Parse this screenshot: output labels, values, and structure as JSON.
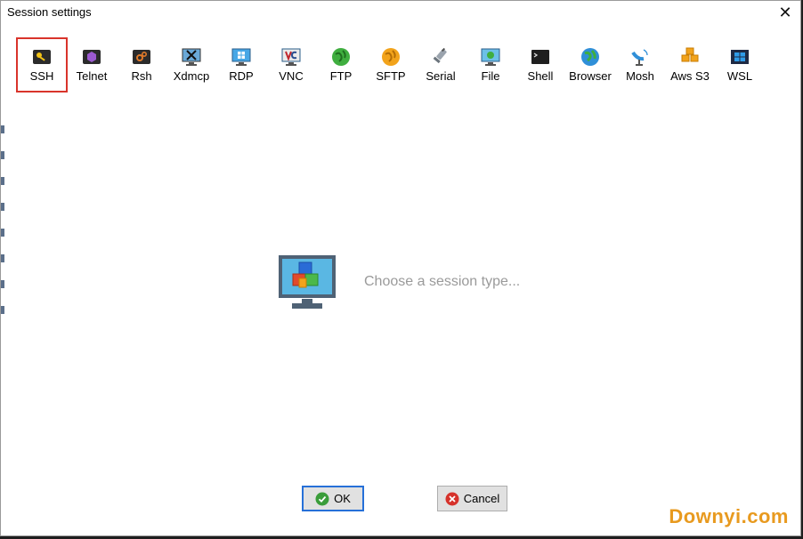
{
  "window": {
    "title": "Session settings",
    "close_glyph": "✕"
  },
  "session_types": [
    {
      "label": "SSH",
      "icon": "key-icon",
      "selected": true
    },
    {
      "label": "Telnet",
      "icon": "telnet-icon"
    },
    {
      "label": "Rsh",
      "icon": "rsh-icon"
    },
    {
      "label": "Xdmcp",
      "icon": "xdmcp-icon"
    },
    {
      "label": "RDP",
      "icon": "rdp-icon"
    },
    {
      "label": "VNC",
      "icon": "vnc-icon"
    },
    {
      "label": "FTP",
      "icon": "ftp-globe-icon"
    },
    {
      "label": "SFTP",
      "icon": "sftp-globe-icon"
    },
    {
      "label": "Serial",
      "icon": "serial-plug-icon"
    },
    {
      "label": "File",
      "icon": "file-monitor-icon"
    },
    {
      "label": "Shell",
      "icon": "shell-terminal-icon"
    },
    {
      "label": "Browser",
      "icon": "browser-globe-icon"
    },
    {
      "label": "Mosh",
      "icon": "mosh-antenna-icon"
    },
    {
      "label": "Aws S3",
      "icon": "aws-s3-cubes-icon"
    },
    {
      "label": "WSL",
      "icon": "wsl-windows-icon"
    }
  ],
  "main": {
    "hint": "Choose a session type..."
  },
  "buttons": {
    "ok_label": "OK",
    "cancel_label": "Cancel"
  },
  "watermark": "Downyi.com",
  "colors": {
    "selection": "#d9342b",
    "ok_border": "#2670d8",
    "watermark": "#e89a1f"
  }
}
